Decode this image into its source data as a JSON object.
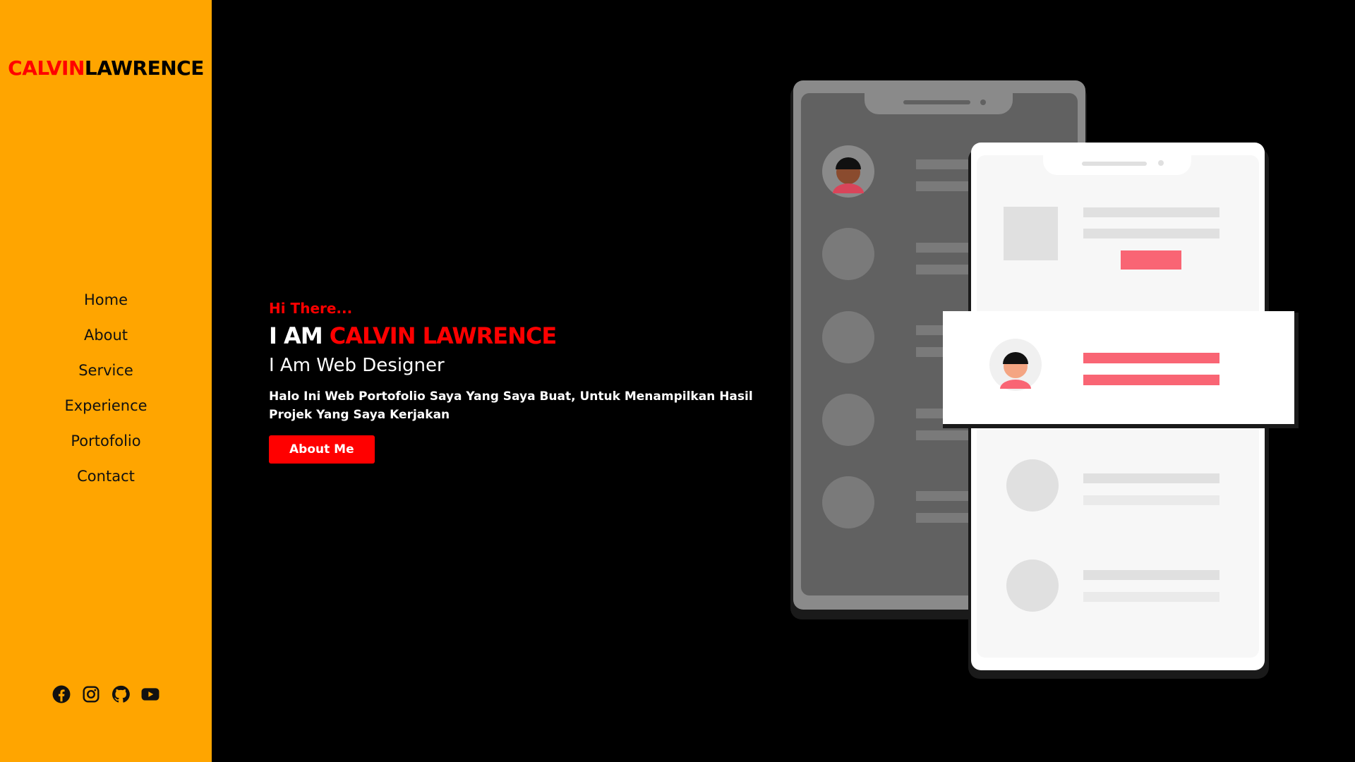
{
  "brand": {
    "first": "CALVIN",
    "last": "LAWRENCE"
  },
  "nav": {
    "items": [
      {
        "label": "Home"
      },
      {
        "label": "About"
      },
      {
        "label": "Service"
      },
      {
        "label": "Experience"
      },
      {
        "label": "Portofolio"
      },
      {
        "label": "Contact"
      }
    ]
  },
  "socials": [
    "facebook-icon",
    "instagram-icon",
    "github-icon",
    "youtube-icon"
  ],
  "hero": {
    "greeting": "Hi There...",
    "title_prefix": "I AM",
    "title_name": "CALVIN LAWRENCE",
    "role": "I Am Web Designer",
    "description": "Halo Ini Web Portofolio Saya Yang Saya Buat, Untuk Menampilkan Hasil Projek Yang Saya Kerjakan",
    "button_label": "About Me"
  },
  "colors": {
    "sidebar_bg": "#FFA500",
    "accent": "#FF0000",
    "page_bg": "#000000",
    "illustration_accent": "#F96574"
  }
}
